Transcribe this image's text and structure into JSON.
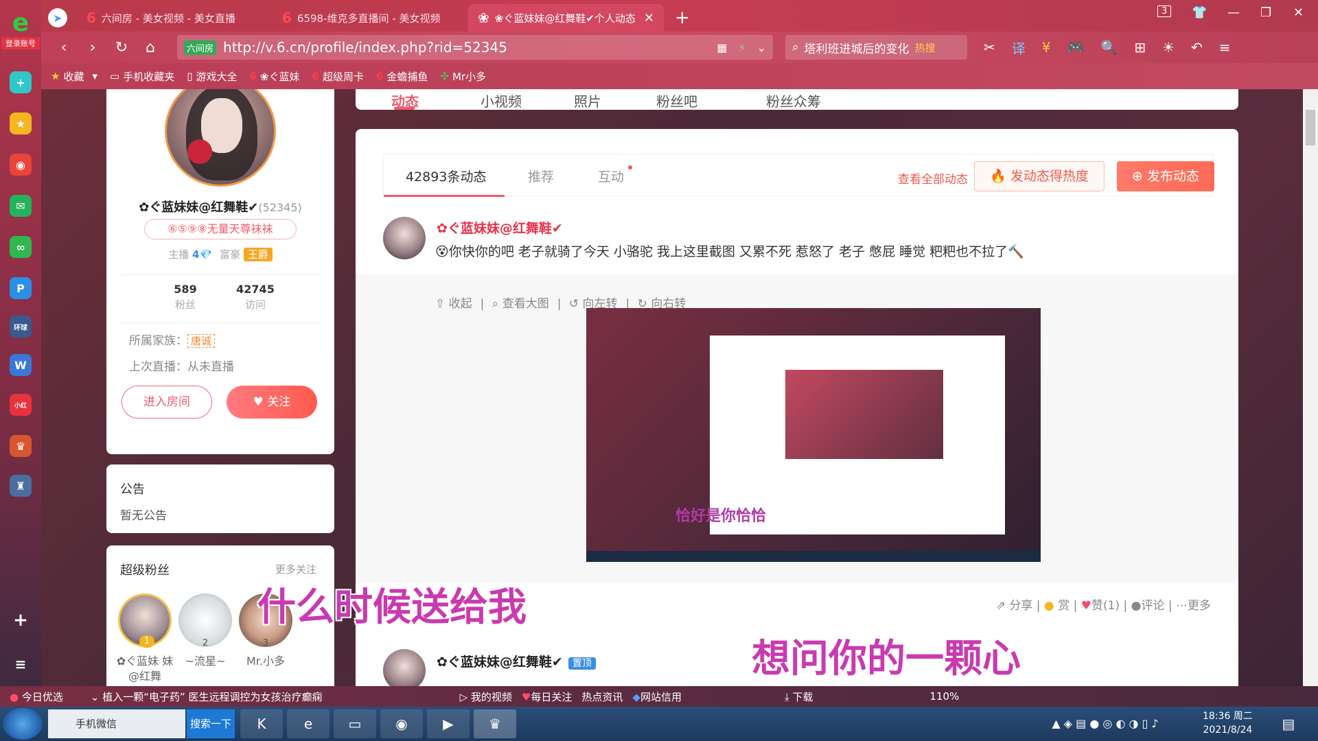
{
  "browser": {
    "tabs": [
      {
        "icon": "6",
        "title": "六间房 - 美女视频 - 美女直播"
      },
      {
        "icon": "6",
        "title": "6598-维克多直播间 - 美女视频"
      },
      {
        "icon": "❀",
        "title": "❀ぐ蓝妹妹@红舞鞋✔个人动态"
      }
    ],
    "new_tab": "+",
    "url_site_label": "六间房",
    "url": "http://v.6.cn/profile/index.php?rid=52345",
    "search_text": "塔利班进城后的变化",
    "search_hot": "热搜",
    "tab_count": "3",
    "bookmarks": [
      "收藏",
      "手机收藏夹",
      "游戏大全",
      "❀ぐ蓝妹",
      "超级周卡",
      "金蟾捕鱼",
      "Mr小多"
    ]
  },
  "sidebar": {
    "login_label": "登录账号"
  },
  "profile": {
    "name": "✿ぐ蓝妹妹@红舞鞋✔",
    "rid": "(52345)",
    "rank_text": "⑥⑤⑨⑧无量天尊袜袜",
    "anchor_label": "主播",
    "anchor_level": "4💎",
    "rich_label": "富豪",
    "rich_badge": "王爵",
    "fans_count": "589",
    "fans_label": "粉丝",
    "visits_count": "42745",
    "visits_label": "访问",
    "family_label": "所属家族：",
    "family_value": "唐诚",
    "last_live": "上次直播：从未直播",
    "enter_room": "进入房间",
    "follow": "关注"
  },
  "notice": {
    "title": "公告",
    "body": "暂无公告"
  },
  "superfans": {
    "title": "超级粉丝",
    "more": "更多关注",
    "fans": [
      {
        "rank": "1",
        "name": "✿ぐ蓝妹 妹@红舞"
      },
      {
        "rank": "2",
        "name": "~流星~"
      },
      {
        "rank": "3",
        "name": "Mr.小多"
      }
    ]
  },
  "profile_tabs": [
    "动态",
    "小视频",
    "照片",
    "粉丝吧",
    "粉丝众筹"
  ],
  "feed": {
    "tabs": [
      "42893条动态",
      "推荐",
      "互动"
    ],
    "view_all": "查看全部动态",
    "hot_button": "发动态得热度",
    "post_button": "发布动态",
    "post1": {
      "author": "✿ぐ蓝妹妹@红舞鞋✔",
      "text": "你快你的吧 老子就骑了今天 小骆驼 我上这里截图 又累不死 惹怒了 老子 憋屁 睡觉 粑粑也不拉了",
      "media_actions": [
        "收起",
        "查看大图",
        "向左转",
        "向右转"
      ],
      "inner_lyric": "恰好是你恰恰",
      "actions": [
        "分享",
        "赏",
        "赞(1)",
        "评论",
        "更多"
      ]
    },
    "post2": {
      "author": "✿ぐ蓝妹妹@红舞鞋✔",
      "pin": "置顶"
    }
  },
  "overlays": {
    "lyric1": "什么时候送给我",
    "lyric2": "想问你的一颗心"
  },
  "statusbar": {
    "left": "今日优选",
    "news": "植入一颗“电子药” 医生远程调控为女孩治疗癫痫",
    "items": [
      "我的视频",
      "每日关注",
      "热点资讯",
      "网站信用",
      "下载"
    ],
    "zoom": "110%"
  },
  "taskbar": {
    "wechat": "手机微信",
    "search": "搜索一下",
    "time": "18:36 周二",
    "date": "2021/8/24"
  }
}
